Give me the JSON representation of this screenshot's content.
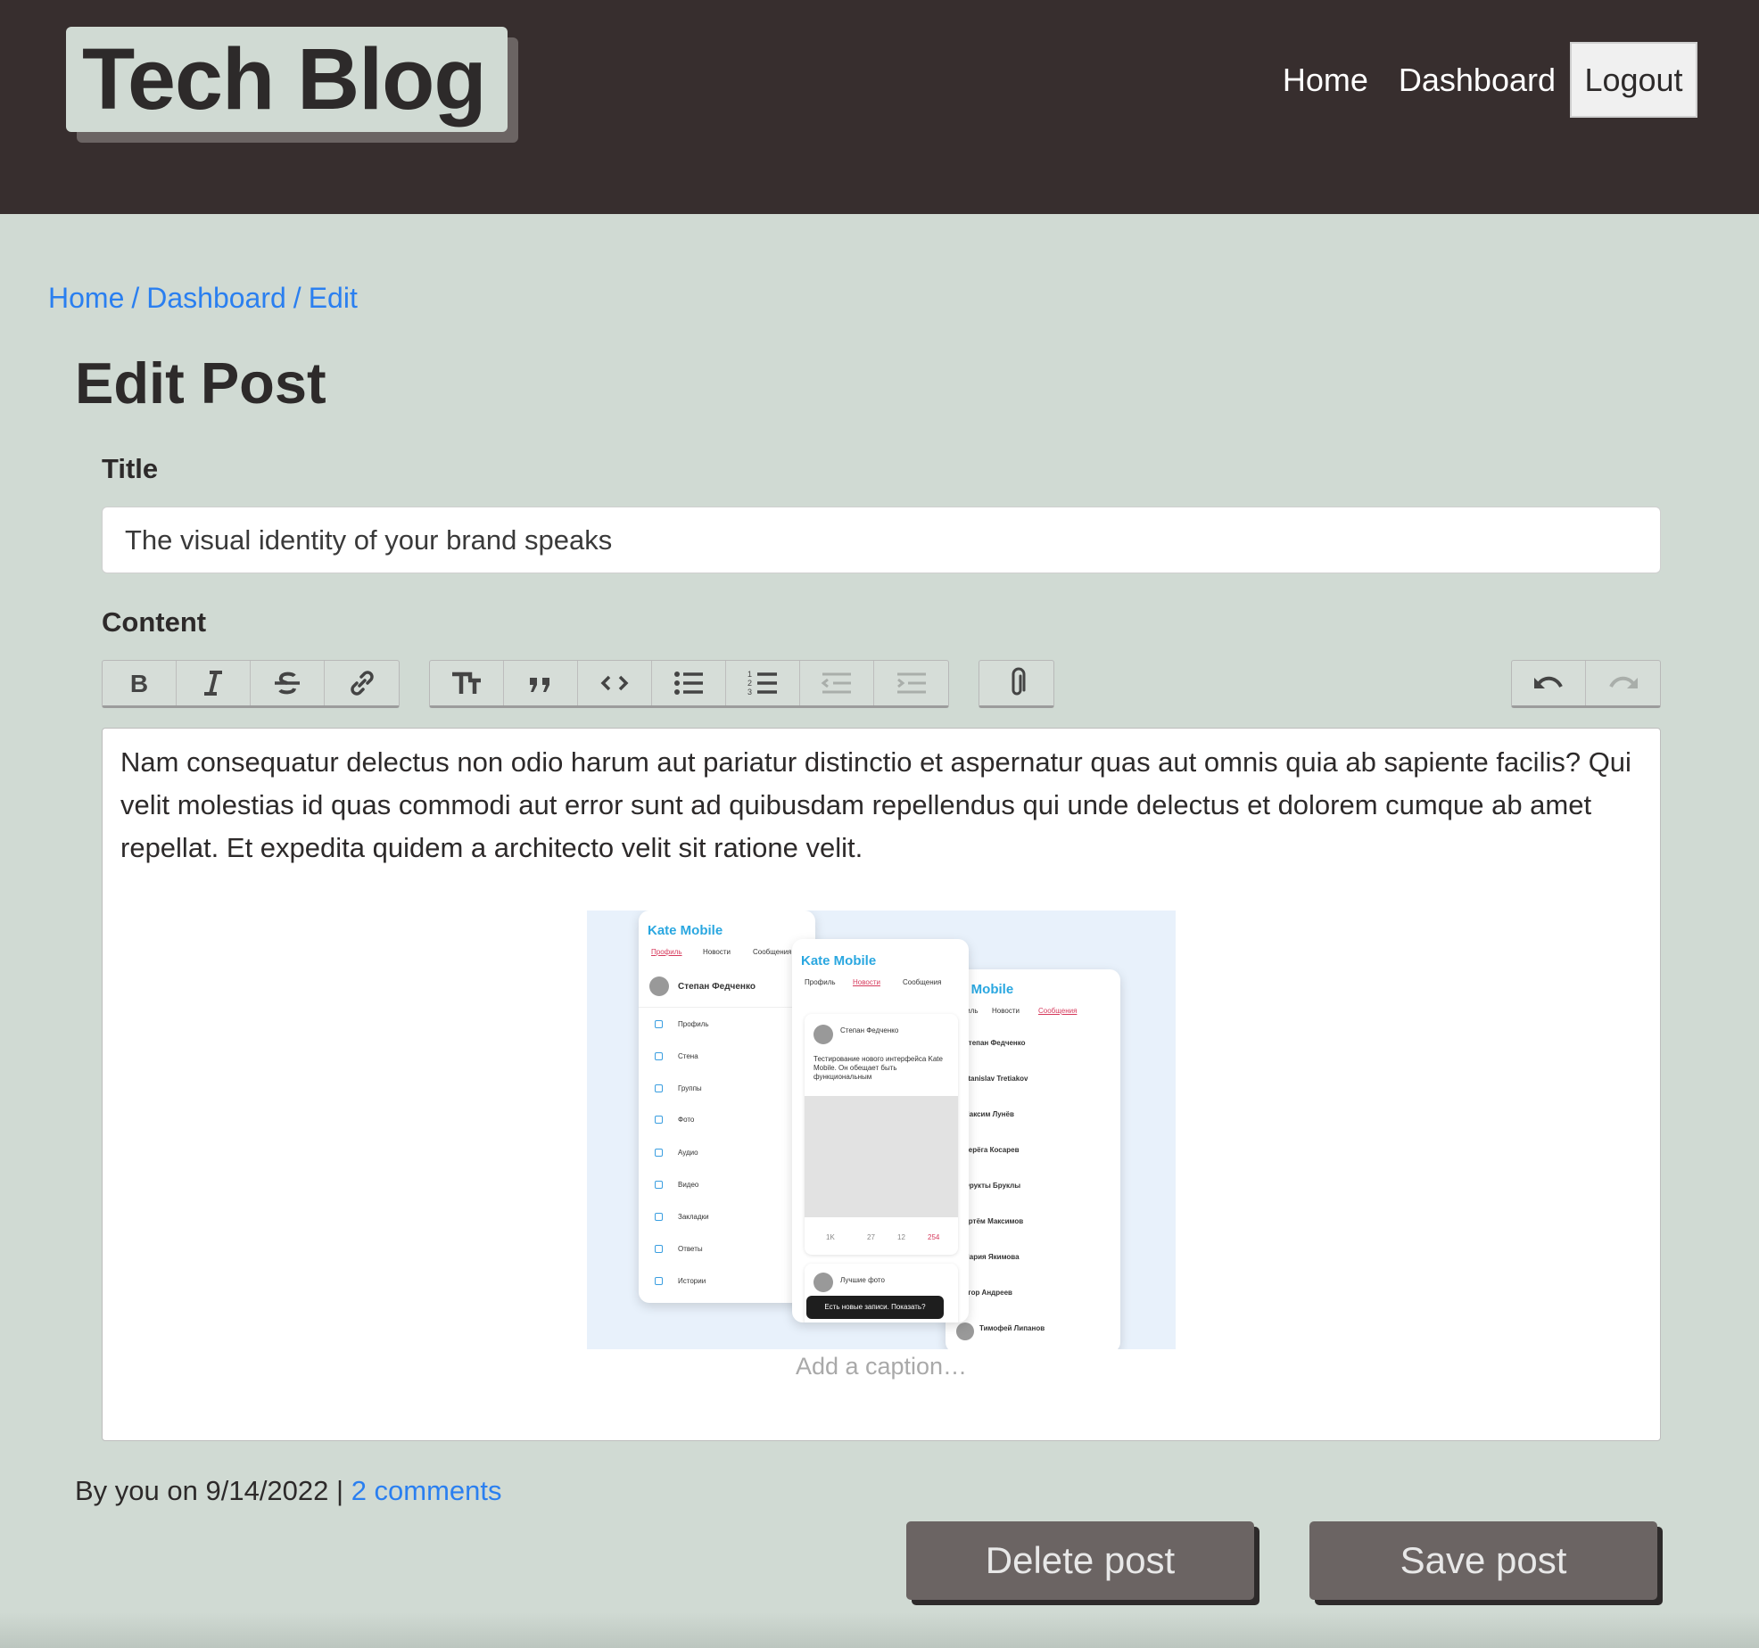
{
  "header": {
    "logo": "Tech Blog",
    "nav": [
      {
        "label": "Home"
      },
      {
        "label": "Dashboard"
      },
      {
        "label": "Logout"
      }
    ]
  },
  "breadcrumb": {
    "items": [
      "Home",
      "Dashboard",
      "Edit"
    ],
    "separator": "/"
  },
  "page_title": "Edit Post",
  "form": {
    "title_label": "Title",
    "title_value": "The visual identity of your brand speaks",
    "content_label": "Content",
    "toolbar": {
      "text_group": [
        "bold-icon",
        "italic-icon",
        "strikethrough-icon",
        "link-icon"
      ],
      "block_group": [
        "heading-icon",
        "quote-icon",
        "code-icon",
        "bullet-list-icon",
        "numbered-list-icon",
        "decrease-indent-icon",
        "increase-indent-icon"
      ],
      "file_group": [
        "attach-icon"
      ],
      "history_group": [
        "undo-icon",
        "redo-icon"
      ]
    },
    "content_text": "Nam consequatur delectus non odio harum aut pariatur distinctio et aspernatur quas aut omnis quia ab sapiente facilis? Qui velit molestias id quas commodi aut error sunt ad quibusdam repellendus qui unde delectus et dolorem cumque ab amet repellat. Et expedita quidem a architecto velit sit ratione velit.",
    "attachment": {
      "app_title": "Kate Mobile",
      "tabs": [
        "Профиль",
        "Новости",
        "Сообщения"
      ],
      "profile_name": "Степан Федченко",
      "menu": [
        "Профиль",
        "Стена",
        "Группы",
        "Фото",
        "Аудио",
        "Видео",
        "Закладки",
        "Ответы",
        "Истории"
      ],
      "post_author": "Степан Федченко",
      "post_text": "Тестирование нового интерфейса Kate Mobile. Он обещает быть функциональным",
      "post_stats": [
        "1K",
        "27",
        "12",
        "254"
      ],
      "second_post": "Лучшие фото",
      "toast": "Есть новые записи. Показать?",
      "contacts": [
        "Степан Федченко",
        "Stanislav Tretiakov",
        "Максим Лунёв",
        "Серёга Косарев",
        "Фрукты Бруклы",
        "Артём Максимов",
        "Мария Якимова",
        "Егор Андреев",
        "Тимофей Липанов"
      ],
      "caption_placeholder": "Add a caption…"
    }
  },
  "meta": {
    "byline": "By you on 9/14/2022 |",
    "comments_link": "2 comments"
  },
  "buttons": {
    "delete": "Delete post",
    "save": "Save post"
  },
  "colors": {
    "header_bg": "#372e2e",
    "page_bg": "#d0dad3",
    "link": "#2a7ff0",
    "button_bg": "#6b6463"
  }
}
